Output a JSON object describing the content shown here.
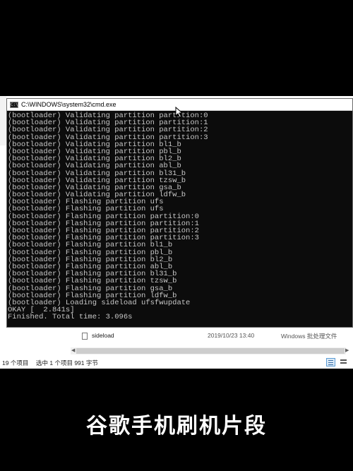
{
  "cmd": {
    "title": "C:\\WINDOWS\\system32\\cmd.exe",
    "icon": "console-icon",
    "lines": [
      "(bootloader) Validating partition partition:0",
      "(bootloader) Validating partition partition:1",
      "(bootloader) Validating partition partition:2",
      "(bootloader) Validating partition partition:3",
      "(bootloader) Validating partition bl1_b",
      "(bootloader) Validating partition pbl_b",
      "(bootloader) Validating partition bl2_b",
      "(bootloader) Validating partition abl_b",
      "(bootloader) Validating partition bl31_b",
      "(bootloader) Validating partition tzsw_b",
      "(bootloader) Validating partition gsa_b",
      "(bootloader) Validating partition ldfw_b",
      "(bootloader) Flashing partition ufs",
      "(bootloader) Flashing partition ufs",
      "(bootloader) Flashing partition partition:0",
      "(bootloader) Flashing partition partition:1",
      "(bootloader) Flashing partition partition:2",
      "(bootloader) Flashing partition partition:3",
      "(bootloader) Flashing partition bl1_b",
      "(bootloader) Flashing partition pbl_b",
      "(bootloader) Flashing partition bl2_b",
      "(bootloader) Flashing partition abl_b",
      "(bootloader) Flashing partition bl31_b",
      "(bootloader) Flashing partition tzsw_b",
      "(bootloader) Flashing partition gsa_b",
      "(bootloader) Flashing partition ldfw_b",
      "(bootloader) Loading sideload ufsfwupdate",
      "OKAY [  2.841s]",
      "Finished. Total time: 3.096s"
    ]
  },
  "explorer": {
    "file_row": {
      "name": "sideload",
      "date": "2019/10/23 13:40",
      "type": "Windows 批处理文件"
    },
    "status": {
      "item_count": "19 个项目",
      "selected": "选中 1 个项目  991 字节"
    },
    "colors": {
      "console_bg": "#0c0c0c",
      "console_text": "#c8c8c8",
      "accent": "#5b9bd5"
    }
  },
  "caption": "谷歌手机刷机片段"
}
